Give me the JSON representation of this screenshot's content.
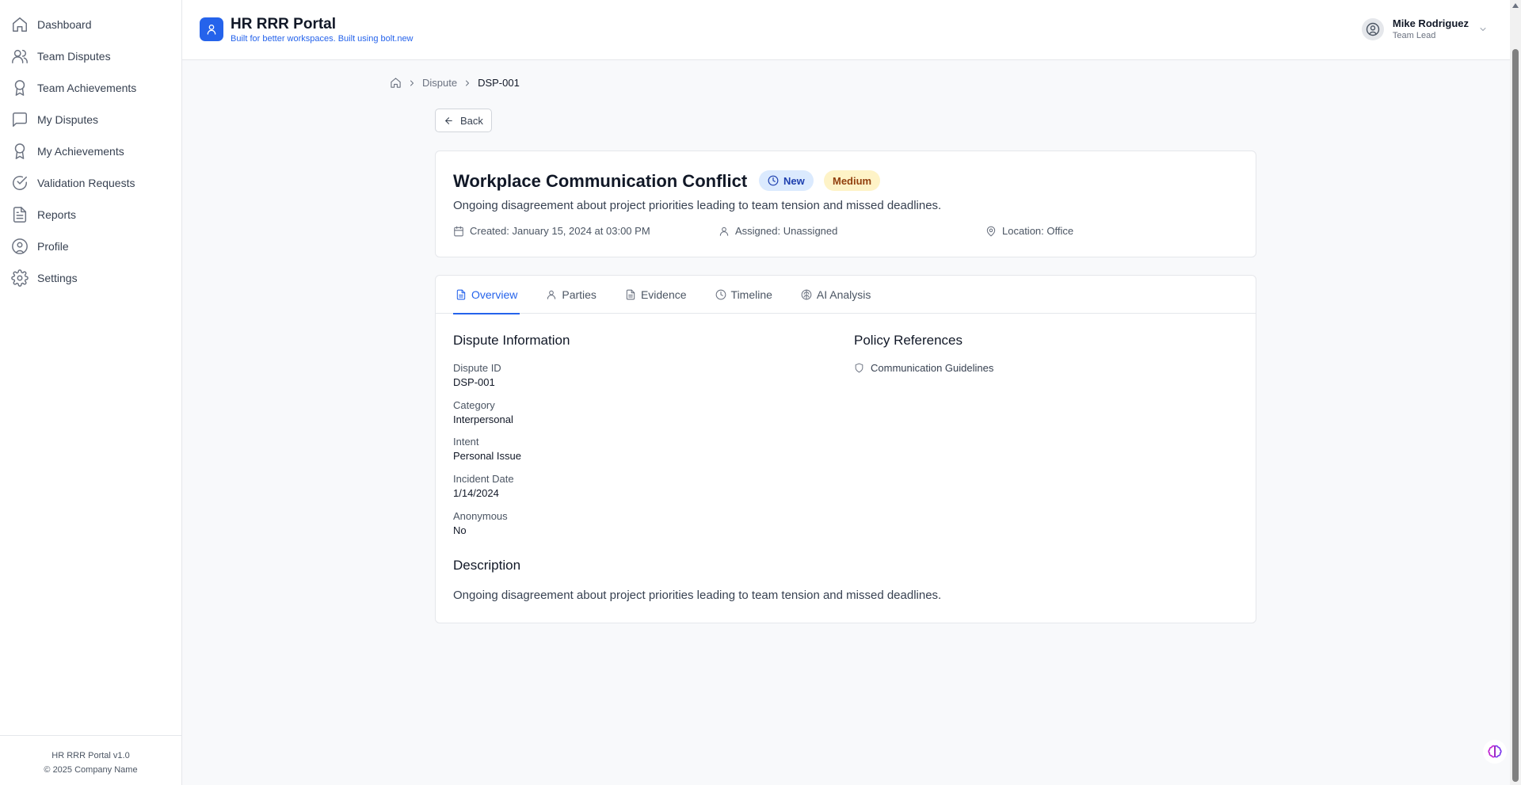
{
  "sidebar": {
    "items": [
      {
        "label": "Dashboard",
        "icon": "home-icon"
      },
      {
        "label": "Team Disputes",
        "icon": "users-icon"
      },
      {
        "label": "Team Achievements",
        "icon": "award-icon"
      },
      {
        "label": "My Disputes",
        "icon": "message-square-icon"
      },
      {
        "label": "My Achievements",
        "icon": "award-icon"
      },
      {
        "label": "Validation Requests",
        "icon": "check-circle-icon"
      },
      {
        "label": "Reports",
        "icon": "file-text-icon"
      },
      {
        "label": "Profile",
        "icon": "user-circle-icon"
      },
      {
        "label": "Settings",
        "icon": "gear-icon"
      }
    ],
    "footer_version": "HR RRR Portal v1.0",
    "footer_copyright": "© 2025 Company Name"
  },
  "header": {
    "title": "HR RRR Portal",
    "subtitle": "Built for better workspaces. Built using bolt.new",
    "user_name": "Mike Rodriguez",
    "user_role": "Team Lead"
  },
  "breadcrumb": {
    "items": [
      "Dispute",
      "DSP-001"
    ]
  },
  "back_label": "Back",
  "dispute": {
    "title": "Workplace Communication Conflict",
    "status": "New",
    "priority": "Medium",
    "summary": "Ongoing disagreement about project priorities leading to team tension and missed deadlines.",
    "created": "Created: January 15, 2024 at 03:00 PM",
    "assigned": "Assigned: Unassigned",
    "location": "Location: Office"
  },
  "tabs": [
    {
      "label": "Overview",
      "icon": "file-text-icon",
      "active": true
    },
    {
      "label": "Parties",
      "icon": "user-icon",
      "active": false
    },
    {
      "label": "Evidence",
      "icon": "file-icon",
      "active": false
    },
    {
      "label": "Timeline",
      "icon": "clock-icon",
      "active": false
    },
    {
      "label": "AI Analysis",
      "icon": "brain-icon",
      "active": false
    }
  ],
  "overview": {
    "info_title": "Dispute Information",
    "fields": [
      {
        "label": "Dispute ID",
        "value": "DSP-001"
      },
      {
        "label": "Category",
        "value": "Interpersonal"
      },
      {
        "label": "Intent",
        "value": "Personal Issue"
      },
      {
        "label": "Incident Date",
        "value": "1/14/2024"
      },
      {
        "label": "Anonymous",
        "value": "No"
      }
    ],
    "policy_title": "Policy References",
    "policies": [
      "Communication Guidelines"
    ],
    "description_title": "Description",
    "description": "Ongoing disagreement about project priorities leading to team tension and missed deadlines."
  },
  "colors": {
    "accent": "#2563eb",
    "badge_new_bg": "#dbeafe",
    "badge_medium_bg": "#fef3c7"
  }
}
